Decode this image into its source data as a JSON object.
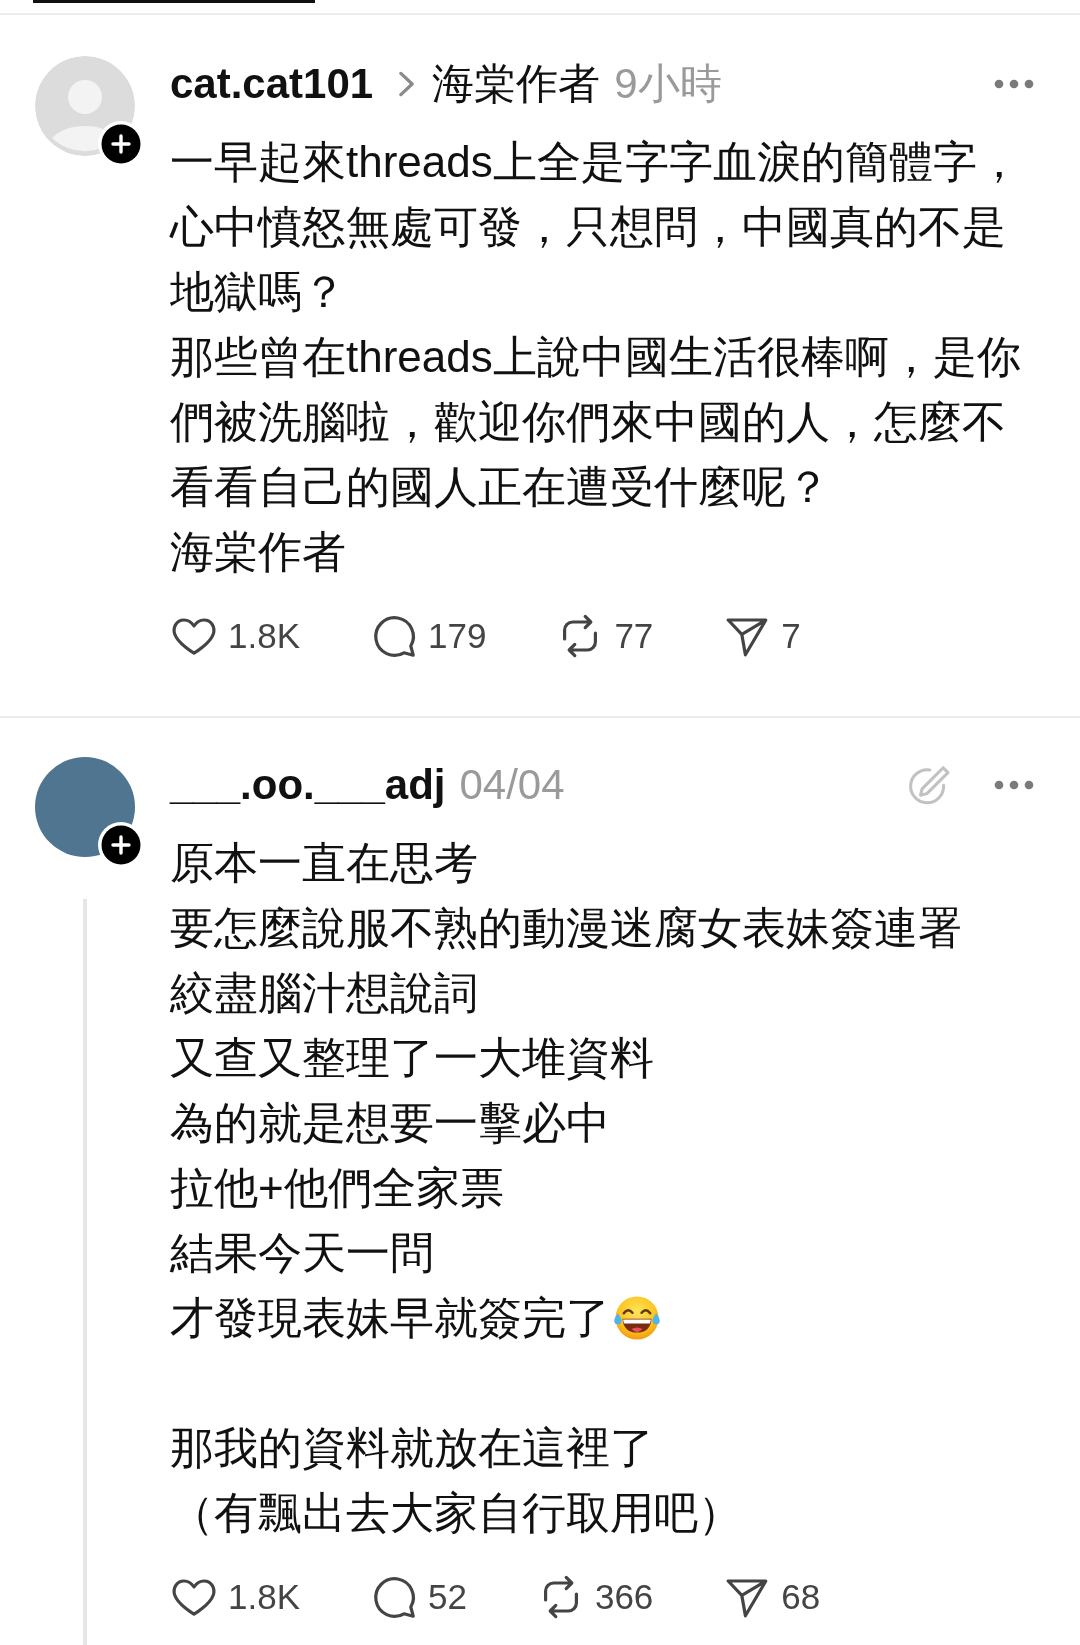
{
  "posts": [
    {
      "avatar": {
        "kind": "default"
      },
      "username": "cat.cat101",
      "topic": "海棠作者",
      "time": "9小時",
      "edit_indicator": false,
      "thread_line": false,
      "paragraphs": [
        {
          "lines": [
            {
              "kind": "text",
              "rows": [
                "一早起來threads上全是字字血淚的簡體字，",
                "心中憤怒無處可發，只想問，中國真的不是",
                "地獄嗎？"
              ]
            },
            {
              "kind": "text",
              "rows": [
                "那些曾在threads上說中國生活很棒啊，是你",
                "們被洗腦啦，歡迎你們來中國的人，怎麼不",
                "看看自己的國人正在遭受什麼呢？"
              ]
            },
            {
              "kind": "text",
              "rows": [
                "海棠作者"
              ]
            }
          ]
        }
      ],
      "actions": [
        {
          "kind": "like",
          "count": "1.8K"
        },
        {
          "kind": "reply",
          "count": "179"
        },
        {
          "kind": "repost",
          "count": "77"
        },
        {
          "kind": "share",
          "count": "7"
        }
      ]
    },
    {
      "avatar": {
        "kind": "photo"
      },
      "username": "___.oo.___adj",
      "time": "04/04",
      "edit_indicator": true,
      "thread_line": true,
      "paragraphs": [
        {
          "lines": [
            {
              "kind": "text",
              "rows": [
                "原本一直在思考"
              ]
            },
            {
              "kind": "text",
              "rows": [
                "要怎麼說服不熟的動漫迷腐女表妹簽連署"
              ]
            },
            {
              "kind": "text",
              "rows": [
                "絞盡腦汁想說詞"
              ]
            },
            {
              "kind": "text",
              "rows": [
                "又查又整理了一大堆資料"
              ]
            },
            {
              "kind": "text",
              "rows": [
                "為的就是想要一擊必中"
              ]
            },
            {
              "kind": "text",
              "rows": [
                "拉他+他們全家票"
              ]
            },
            {
              "kind": "text",
              "rows": [
                "結果今天一問"
              ]
            },
            {
              "kind": "text_emoji",
              "rows": [
                "才發現表妹早就簽完了"
              ]
            }
          ]
        },
        {
          "lines": [
            {
              "kind": "text",
              "rows": [
                "那我的資料就放在這裡了"
              ]
            },
            {
              "kind": "text",
              "rows": [
                "（有飄出去大家自行取用吧）"
              ]
            }
          ]
        }
      ],
      "actions": [
        {
          "kind": "like",
          "count": "1.8K"
        },
        {
          "kind": "reply",
          "count": "52"
        },
        {
          "kind": "repost",
          "count": "366"
        },
        {
          "kind": "share",
          "count": "68"
        }
      ]
    }
  ]
}
